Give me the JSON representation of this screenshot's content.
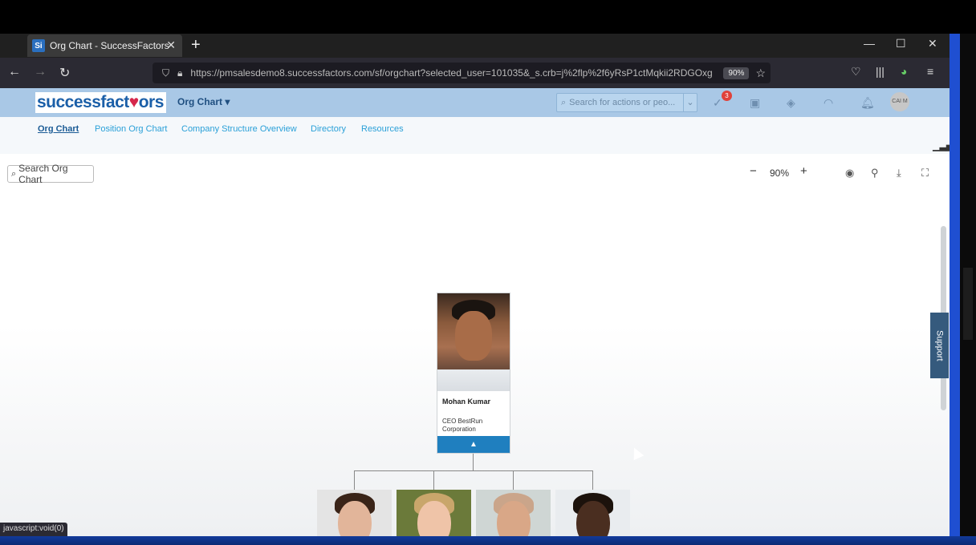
{
  "browser": {
    "tab_title": "Org Chart - SuccessFactors",
    "favicon_text": "Si",
    "url": "https://pmsalesdemo8.successfactors.com/sf/orgchart?selected_user=101035&_s.crb=j%2flp%2f6yRsP1ctMqkii2RDGOxg",
    "zoom": "90%",
    "status_text": "javascript:void(0)"
  },
  "sf_header": {
    "logo_text_a": "successfact",
    "logo_text_b": "or",
    "logo_text_c": "s",
    "module": "Org Chart",
    "search_placeholder": "Search for actions or peo...",
    "notification_count": "3",
    "avatar_text": "CAI M"
  },
  "subnav": {
    "items": [
      {
        "label": "Org Chart"
      },
      {
        "label": "Position Org Chart"
      },
      {
        "label": "Company Structure Overview"
      },
      {
        "label": "Directory"
      },
      {
        "label": "Resources"
      }
    ]
  },
  "toolbar": {
    "search_placeholder": "Search Org Chart",
    "zoom_level": "90%"
  },
  "support_label": "Support",
  "ceo": {
    "name": "Mohan Kumar",
    "title": "CEO BestRun Corporation"
  },
  "colors": {
    "sf_header_bg": "#a9c8e6",
    "link": "#2aa0d8",
    "expand_bar": "#1f7fbf",
    "notification": "#e0423a"
  }
}
